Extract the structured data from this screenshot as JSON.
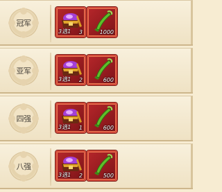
{
  "rows": [
    {
      "rank_label": "冠军",
      "chest_label": "3选1",
      "chest_count": "3",
      "currency_amount": "1000"
    },
    {
      "rank_label": "亚军",
      "chest_label": "3选1",
      "chest_count": "2",
      "currency_amount": "600"
    },
    {
      "rank_label": "四强",
      "chest_label": "3选1",
      "chest_count": "1",
      "currency_amount": "600"
    },
    {
      "rank_label": "八强",
      "chest_label": "3选1",
      "chest_count": "2",
      "currency_amount": "500"
    }
  ],
  "icons": {
    "chest": "treasure-chest-icon",
    "currency": "green-jade-scroll-icon"
  },
  "colors": {
    "background": "#f7ecd2",
    "item_frame": "#b5262a",
    "currency_icon": "#5fbf2a"
  }
}
